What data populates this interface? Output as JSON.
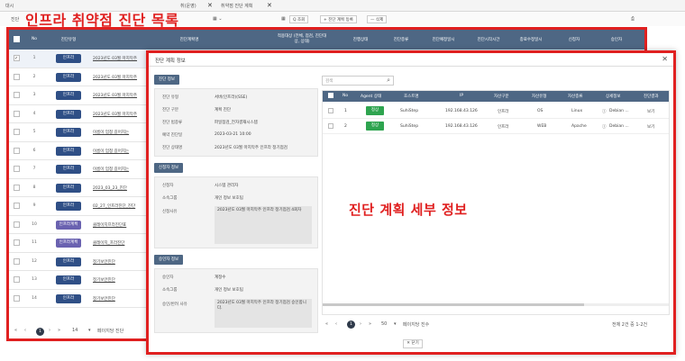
{
  "annotations": {
    "list_title": "인프라 취약점 진단 목록",
    "detail_label": "진단 계획 세부 정보"
  },
  "window": {
    "tabs": [
      "대시",
      "취(운영)",
      "취약점 진단 계획"
    ],
    "close_glyph": "✕"
  },
  "toolbar": {
    "left_label": "진단",
    "search_label": "Q 조회",
    "register_label": "+ 진단 계획 등록",
    "delete_label": "— 삭제"
  },
  "list": {
    "columns": [
      "No",
      "진단유형",
      "진단계획명",
      "적용대상 (전체, 점검, 진단대상, 상태)",
      "진행상태",
      "진단종류",
      "진단예정일시",
      "진단시작시간",
      "종료수정일시",
      "신청자",
      "승인자"
    ],
    "rows": [
      {
        "no": "1",
        "type": "인프라",
        "name": "2023년도 03월 마지막주"
      },
      {
        "no": "2",
        "type": "인프라",
        "name": "2023년도 03월 마지막주"
      },
      {
        "no": "3",
        "type": "인프라",
        "name": "2023년도 03월 마지막주"
      },
      {
        "no": "4",
        "type": "인프라",
        "name": "2023년도 03월 마지막주"
      },
      {
        "no": "5",
        "type": "인프라",
        "name": "이름이 엄청 길어지는"
      },
      {
        "no": "6",
        "type": "인프라",
        "name": "이름이 엄청 길어지는"
      },
      {
        "no": "7",
        "type": "인프라",
        "name": "이름이 엄청 길어지는"
      },
      {
        "no": "8",
        "type": "인프라",
        "name": "2023_03_23_진단"
      },
      {
        "no": "9",
        "type": "인프라",
        "name": "02_27_인프라진단_진단"
      },
      {
        "no": "10",
        "type": "인프라계획",
        "name": "클레이지프라진단표"
      },
      {
        "no": "11",
        "type": "인프라계획",
        "name": "클레이지_프라진단"
      },
      {
        "no": "12",
        "type": "인프라",
        "name": "정기보안진단"
      },
      {
        "no": "13",
        "type": "인프라",
        "name": "정기보안진단"
      },
      {
        "no": "14",
        "type": "인프라",
        "name": "정기보안진단"
      }
    ],
    "pager": {
      "current": "1",
      "per_page": "14",
      "label": "페이지당 진단"
    }
  },
  "modal": {
    "title": "진단 계획 정보",
    "close_glyph": "✕",
    "sections": {
      "diagnosis": {
        "badge": "진단 정보",
        "fields": [
          {
            "label": "진단 유형",
            "value": "서버(인프라)(SSE)"
          },
          {
            "label": "진단 구분",
            "value": "계획 진단"
          },
          {
            "label": "진단 범종류",
            "value": "파일점검_전자결재시스템"
          },
          {
            "label": "예약 진단일",
            "value": "2023-03-21 10:00"
          },
          {
            "label": "진단 상태명",
            "value": "2023년도 03월 마지막주 인프라 정기점검"
          }
        ]
      },
      "applicant": {
        "badge": "신청자 정보",
        "fields": [
          {
            "label": "신청자",
            "value": "시스템 관리자"
          },
          {
            "label": "소속그룹",
            "value": "개인 정보 보호팀"
          },
          {
            "label": "신청사유",
            "value": "2023년도 03월 마지막주 인프라 정기점검 4회차"
          }
        ]
      },
      "approver": {
        "badge": "승인자 정보",
        "fields": [
          {
            "label": "승인자",
            "value": "계정수"
          },
          {
            "label": "소속그룹",
            "value": "개인 정보 보호팀"
          },
          {
            "label": "승인/반려 사유",
            "value": "2023년도 03월 마지막주 인프라 정기점검 승인합니다."
          }
        ]
      }
    },
    "search": {
      "placeholder": "검색",
      "icon": "search-icon"
    },
    "target_table": {
      "columns": [
        "No",
        "Agent 상태",
        "호스트명",
        "IP",
        "자산구분",
        "자산유형",
        "자산종류",
        "상세정보",
        "진단결과"
      ],
      "rows": [
        {
          "no": "1",
          "agent": "정상",
          "host": "SuhiStep",
          "ip": "192.168.43.126",
          "asset_class": "인프라",
          "asset_type": "OS",
          "asset_kind": "Linux",
          "detail": "Debian ...",
          "result": "보기"
        },
        {
          "no": "2",
          "agent": "정상",
          "host": "SuhiStep",
          "ip": "192.168.43.126",
          "asset_class": "인프라",
          "asset_type": "WEB",
          "asset_kind": "Apache",
          "detail": "Debian ...",
          "result": "보기"
        }
      ]
    },
    "pager": {
      "current": "1",
      "per_page": "50",
      "label": "페이지당 진수",
      "summary": "전체 2건 중 1-2건"
    },
    "close_button": "✕ 닫기"
  },
  "colors": {
    "header_blue": "#4e6784",
    "pill_navy": "#2f4f86",
    "annotation_red": "#e02020",
    "status_green": "#2ea44f"
  }
}
